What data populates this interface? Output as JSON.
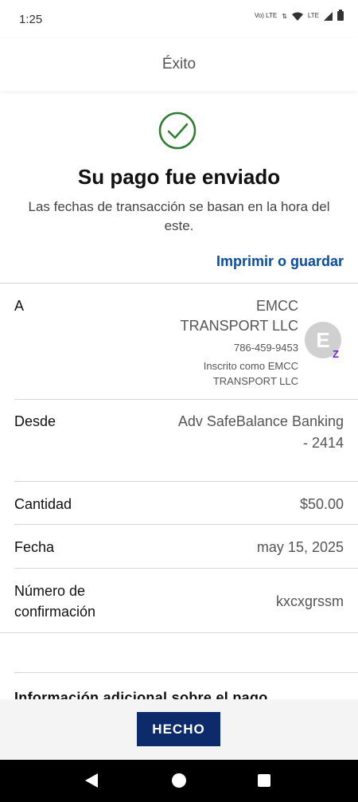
{
  "status_bar": {
    "time": "1:25",
    "vo_lte": "Vo) LTE",
    "lte": "LTE"
  },
  "header": {
    "title": "Éxito"
  },
  "success": {
    "title": "Su pago fue enviado",
    "subtitle": "Las fechas de transacción se basan en la hora del este.",
    "print_label": "Imprimir o guardar"
  },
  "recipient": {
    "label": "A",
    "name_line1": "EMCC",
    "name_line2": "TRANSPORT LLC",
    "phone": "786-459-9453",
    "enrolled_line1": "Inscrito como EMCC",
    "enrolled_line2": "TRANSPORT LLC",
    "avatar_letter": "E",
    "badge": "Z"
  },
  "from": {
    "label": "Desde",
    "value_line1": "Adv SafeBalance Banking",
    "value_line2": "- 2414"
  },
  "amount": {
    "label": "Cantidad",
    "value": "$50.00"
  },
  "date": {
    "label": "Fecha",
    "value": "may 15, 2025"
  },
  "confirmation": {
    "label_line1": "Número de",
    "label_line2": "confirmación",
    "value": "kxcxgrssm"
  },
  "more_info_partial": "Información adicional sobre el pago",
  "done_button": "HECHO",
  "colors": {
    "accent": "#0a4da2",
    "button": "#0d2b6b",
    "success": "#2e7d32",
    "zelle": "#6d1ed4"
  }
}
